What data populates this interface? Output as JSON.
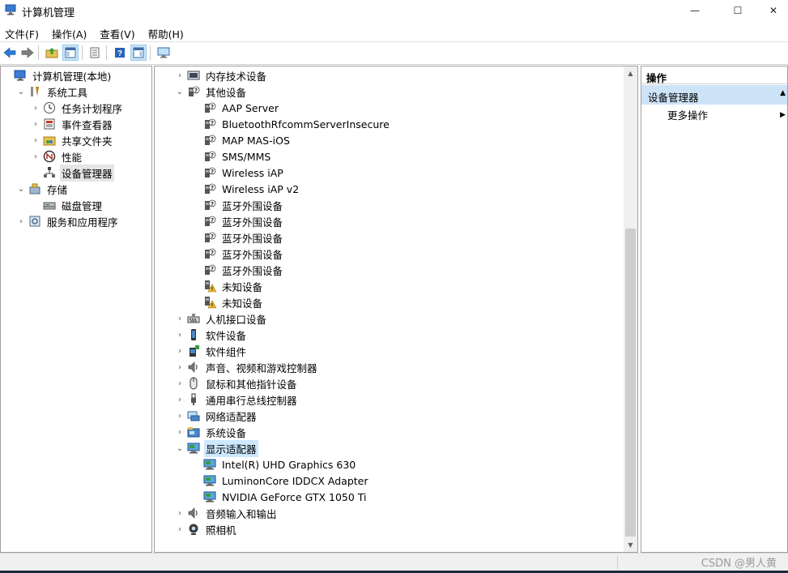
{
  "window": {
    "title": "计算机管理",
    "controls": [
      "—",
      "☐",
      "✕"
    ]
  },
  "menu": [
    "文件(F)",
    "操作(A)",
    "查看(V)",
    "帮助(H)"
  ],
  "toolbar": [
    "back-arrow",
    "forward-arrow",
    "up-folder",
    "show-console-tree",
    "properties",
    "help",
    "action-pane",
    "monitor"
  ],
  "left_tree": [
    {
      "label": "计算机管理(本地)",
      "icon": "computer-management-icon",
      "expander": "",
      "level": 0
    },
    {
      "label": "系统工具",
      "icon": "tools-icon",
      "expander": "⌄",
      "level": 1
    },
    {
      "label": "任务计划程序",
      "icon": "clock-icon",
      "expander": "›",
      "level": 2
    },
    {
      "label": "事件查看器",
      "icon": "event-viewer-icon",
      "expander": "›",
      "level": 2
    },
    {
      "label": "共享文件夹",
      "icon": "shared-folder-icon",
      "expander": "›",
      "level": 2
    },
    {
      "label": "性能",
      "icon": "performance-icon",
      "expander": "›",
      "level": 2
    },
    {
      "label": "设备管理器",
      "icon": "device-manager-icon",
      "expander": "",
      "level": 2,
      "selected": true
    },
    {
      "label": "存储",
      "icon": "storage-icon",
      "expander": "⌄",
      "level": 1
    },
    {
      "label": "磁盘管理",
      "icon": "disk-icon",
      "expander": "",
      "level": 2
    },
    {
      "label": "服务和应用程序",
      "icon": "services-icon",
      "expander": "›",
      "level": 1
    }
  ],
  "devices": [
    {
      "label": "内存技术设备",
      "icon": "memory-device-icon",
      "expander": "›",
      "level": 0
    },
    {
      "label": "其他设备",
      "icon": "unknown-device-icon",
      "expander": "⌄",
      "level": 0
    },
    {
      "label": "AAP Server",
      "icon": "unknown-device-icon",
      "expander": "",
      "level": 1
    },
    {
      "label": "BluetoothRfcommServerInsecure",
      "icon": "unknown-device-icon",
      "expander": "",
      "level": 1
    },
    {
      "label": "MAP MAS-iOS",
      "icon": "unknown-device-icon",
      "expander": "",
      "level": 1
    },
    {
      "label": "SMS/MMS",
      "icon": "unknown-device-icon",
      "expander": "",
      "level": 1
    },
    {
      "label": "Wireless iAP",
      "icon": "unknown-device-icon",
      "expander": "",
      "level": 1
    },
    {
      "label": "Wireless iAP v2",
      "icon": "unknown-device-icon",
      "expander": "",
      "level": 1
    },
    {
      "label": "蓝牙外围设备",
      "icon": "unknown-device-icon",
      "expander": "",
      "level": 1
    },
    {
      "label": "蓝牙外围设备",
      "icon": "unknown-device-icon",
      "expander": "",
      "level": 1
    },
    {
      "label": "蓝牙外围设备",
      "icon": "unknown-device-icon",
      "expander": "",
      "level": 1
    },
    {
      "label": "蓝牙外围设备",
      "icon": "unknown-device-icon",
      "expander": "",
      "level": 1
    },
    {
      "label": "蓝牙外围设备",
      "icon": "unknown-device-icon",
      "expander": "",
      "level": 1
    },
    {
      "label": "未知设备",
      "icon": "warning-device-icon",
      "expander": "",
      "level": 1
    },
    {
      "label": "未知设备",
      "icon": "warning-device-icon",
      "expander": "",
      "level": 1
    },
    {
      "label": "人机接口设备",
      "icon": "hid-icon",
      "expander": "›",
      "level": 0
    },
    {
      "label": "软件设备",
      "icon": "software-device-icon",
      "expander": "›",
      "level": 0
    },
    {
      "label": "软件组件",
      "icon": "software-component-icon",
      "expander": "›",
      "level": 0
    },
    {
      "label": "声音、视频和游戏控制器",
      "icon": "speaker-icon",
      "expander": "›",
      "level": 0
    },
    {
      "label": "鼠标和其他指针设备",
      "icon": "mouse-icon",
      "expander": "›",
      "level": 0
    },
    {
      "label": "通用串行总线控制器",
      "icon": "usb-icon",
      "expander": "›",
      "level": 0
    },
    {
      "label": "网络适配器",
      "icon": "network-adapter-icon",
      "expander": "›",
      "level": 0
    },
    {
      "label": "系统设备",
      "icon": "system-device-icon",
      "expander": "›",
      "level": 0
    },
    {
      "label": "显示适配器",
      "icon": "display-adapter-icon",
      "expander": "⌄",
      "level": 0,
      "selected": true
    },
    {
      "label": "Intel(R) UHD Graphics 630",
      "icon": "display-adapter-icon",
      "expander": "",
      "level": 1
    },
    {
      "label": "LuminonCore IDDCX Adapter",
      "icon": "display-adapter-icon",
      "expander": "",
      "level": 1
    },
    {
      "label": "NVIDIA GeForce GTX 1050 Ti",
      "icon": "display-adapter-icon",
      "expander": "",
      "level": 1
    },
    {
      "label": "音频输入和输出",
      "icon": "speaker-icon",
      "expander": "›",
      "level": 0
    },
    {
      "label": "照相机",
      "icon": "camera-icon",
      "expander": "›",
      "level": 0
    }
  ],
  "actions": {
    "header": "操作",
    "section": "设备管理器",
    "items": [
      "更多操作"
    ]
  },
  "watermark": "CSDN @男人黄",
  "colors": {
    "selection": "#cce8ff",
    "action_section": "#cde3f7",
    "accent": "#0078d7"
  }
}
